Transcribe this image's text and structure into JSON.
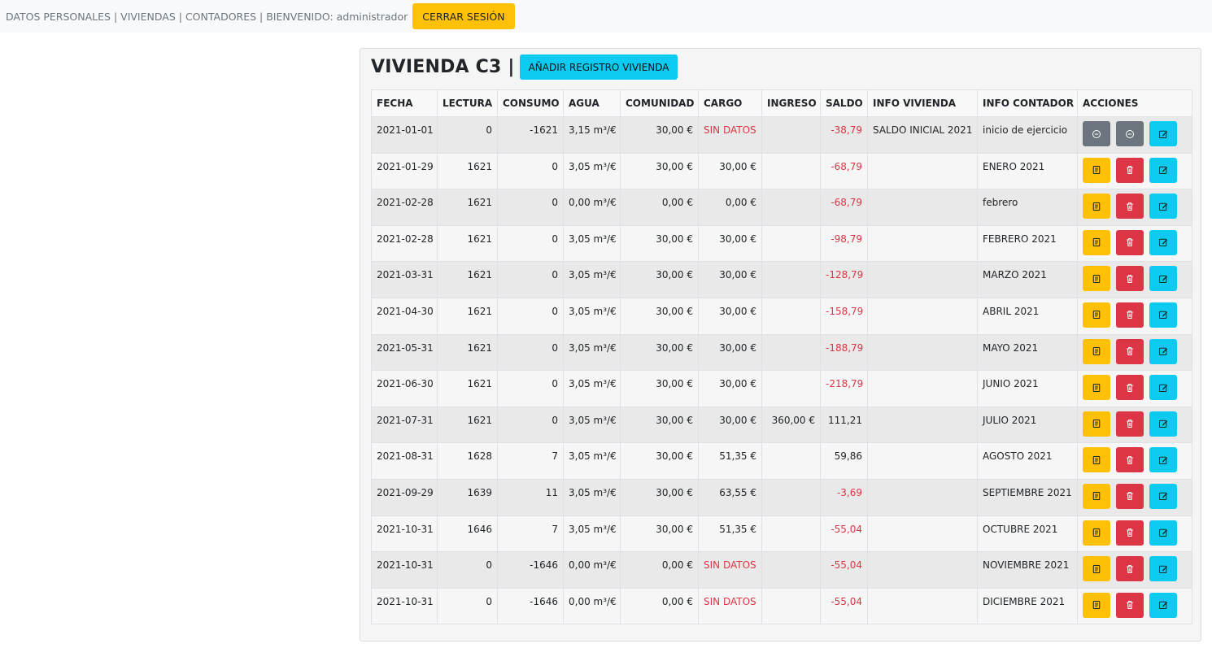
{
  "nav": {
    "items": [
      {
        "label": "DATOS PERSONALES",
        "sep": " | "
      },
      {
        "label": "VIVIENDAS",
        "sep": " | "
      },
      {
        "label": "CONTADORES",
        "sep": " "
      }
    ],
    "welcome": "| BIENVENIDO: administrador",
    "logout_label": "CERRAR SESIÓN"
  },
  "card": {
    "title": "VIVIENDA C3 |",
    "add_button_label": "AÑADIR REGISTRO VIVIENDA"
  },
  "table": {
    "headers": [
      "FECHA",
      "LECTURA",
      "CONSUMO",
      "AGUA",
      "COMUNIDAD",
      "CARGO",
      "INGRESO",
      "SALDO",
      "INFO VIVIENDA",
      "INFO CONTADOR",
      "ACCIONES"
    ],
    "rows": [
      {
        "fecha": "2021-01-01",
        "lectura": "0",
        "consumo": "-1621",
        "agua": "3,15 m³/€",
        "comunidad": "30,00 €",
        "cargo": "SIN DATOS",
        "ingreso": "",
        "saldo": "-38,79",
        "info_vivienda": "SALDO INICIAL 2021",
        "info_contador": "inicio de ejercicio",
        "locked": true
      },
      {
        "fecha": "2021-01-29",
        "lectura": "1621",
        "consumo": "0",
        "agua": "3,05 m³/€",
        "comunidad": "30,00 €",
        "cargo": "30,00 €",
        "ingreso": "",
        "saldo": "-68,79",
        "info_vivienda": "",
        "info_contador": "ENERO 2021",
        "locked": false
      },
      {
        "fecha": "2021-02-28",
        "lectura": "1621",
        "consumo": "0",
        "agua": "0,00 m³/€",
        "comunidad": "0,00 €",
        "cargo": "0,00 €",
        "ingreso": "",
        "saldo": "-68,79",
        "info_vivienda": "",
        "info_contador": "febrero",
        "locked": false
      },
      {
        "fecha": "2021-02-28",
        "lectura": "1621",
        "consumo": "0",
        "agua": "3,05 m³/€",
        "comunidad": "30,00 €",
        "cargo": "30,00 €",
        "ingreso": "",
        "saldo": "-98,79",
        "info_vivienda": "",
        "info_contador": "FEBRERO 2021",
        "locked": false
      },
      {
        "fecha": "2021-03-31",
        "lectura": "1621",
        "consumo": "0",
        "agua": "3,05 m³/€",
        "comunidad": "30,00 €",
        "cargo": "30,00 €",
        "ingreso": "",
        "saldo": "-128,79",
        "info_vivienda": "",
        "info_contador": "MARZO 2021",
        "locked": false
      },
      {
        "fecha": "2021-04-30",
        "lectura": "1621",
        "consumo": "0",
        "agua": "3,05 m³/€",
        "comunidad": "30,00 €",
        "cargo": "30,00 €",
        "ingreso": "",
        "saldo": "-158,79",
        "info_vivienda": "",
        "info_contador": "ABRIL 2021",
        "locked": false
      },
      {
        "fecha": "2021-05-31",
        "lectura": "1621",
        "consumo": "0",
        "agua": "3,05 m³/€",
        "comunidad": "30,00 €",
        "cargo": "30,00 €",
        "ingreso": "",
        "saldo": "-188,79",
        "info_vivienda": "",
        "info_contador": "MAYO 2021",
        "locked": false
      },
      {
        "fecha": "2021-06-30",
        "lectura": "1621",
        "consumo": "0",
        "agua": "3,05 m³/€",
        "comunidad": "30,00 €",
        "cargo": "30,00 €",
        "ingreso": "",
        "saldo": "-218,79",
        "info_vivienda": "",
        "info_contador": "JUNIO 2021",
        "locked": false
      },
      {
        "fecha": "2021-07-31",
        "lectura": "1621",
        "consumo": "0",
        "agua": "3,05 m³/€",
        "comunidad": "30,00 €",
        "cargo": "30,00 €",
        "ingreso": "360,00 €",
        "saldo": "111,21",
        "info_vivienda": "",
        "info_contador": "JULIO 2021",
        "locked": false
      },
      {
        "fecha": "2021-08-31",
        "lectura": "1628",
        "consumo": "7",
        "agua": "3,05 m³/€",
        "comunidad": "30,00 €",
        "cargo": "51,35 €",
        "ingreso": "",
        "saldo": "59,86",
        "info_vivienda": "",
        "info_contador": "AGOSTO 2021",
        "locked": false
      },
      {
        "fecha": "2021-09-29",
        "lectura": "1639",
        "consumo": "11",
        "agua": "3,05 m³/€",
        "comunidad": "30,00 €",
        "cargo": "63,55 €",
        "ingreso": "",
        "saldo": "-3,69",
        "info_vivienda": "",
        "info_contador": "SEPTIEMBRE 2021",
        "locked": false
      },
      {
        "fecha": "2021-10-31",
        "lectura": "1646",
        "consumo": "7",
        "agua": "3,05 m³/€",
        "comunidad": "30,00 €",
        "cargo": "51,35 €",
        "ingreso": "",
        "saldo": "-55,04",
        "info_vivienda": "",
        "info_contador": "OCTUBRE 2021",
        "locked": false
      },
      {
        "fecha": "2021-10-31",
        "lectura": "0",
        "consumo": "-1646",
        "agua": "0,00 m³/€",
        "comunidad": "0,00 €",
        "cargo": "SIN DATOS",
        "ingreso": "",
        "saldo": "-55,04",
        "info_vivienda": "",
        "info_contador": "NOVIEMBRE 2021",
        "locked": false
      },
      {
        "fecha": "2021-10-31",
        "lectura": "0",
        "consumo": "-1646",
        "agua": "0,00 m³/€",
        "comunidad": "0,00 €",
        "cargo": "SIN DATOS",
        "ingreso": "",
        "saldo": "-55,04",
        "info_vivienda": "",
        "info_contador": "DICIEMBRE 2021",
        "locked": false
      }
    ]
  },
  "icons": {
    "receipt": "receipt-icon",
    "delete": "trash-icon",
    "edit": "edit-icon",
    "disabled": "dash-circle-icon"
  },
  "colors": {
    "warning": "#ffc107",
    "danger": "#dc3545",
    "info": "#0dcaf0",
    "secondary": "#6c757d"
  }
}
